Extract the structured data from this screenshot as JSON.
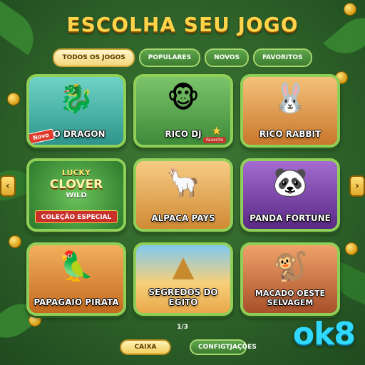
{
  "header": {
    "title": "ESCOLHA SEU JOGO"
  },
  "tabs": [
    {
      "label": "TODOS OS JOGOS",
      "active": true
    },
    {
      "label": "POPULARES",
      "active": false
    },
    {
      "label": "NOVOS",
      "active": false
    },
    {
      "label": "FAVORITOS",
      "active": false
    }
  ],
  "games": [
    {
      "name": "YO DRAGON",
      "badge": "Novo",
      "icon": "dragon-icon",
      "glyph": "🐉",
      "bg": "#3fb3a8"
    },
    {
      "name": "RICO DJ",
      "badge": "Favorito",
      "icon": "monkey-dj-icon",
      "glyph": "🐵",
      "bg": "#4aa05a"
    },
    {
      "name": "RICO RABBIT",
      "icon": "rabbit-icon",
      "glyph": "🐰",
      "bg": "#d98b3a"
    },
    {
      "name": "LUCKY CLOVER WILD",
      "logo_lines": [
        "LUCKY",
        "CLOVER",
        "WILD"
      ],
      "banner": "COLEÇÃO ESPECIAL",
      "icon": "clover-icon",
      "bg": "#3f9a3a"
    },
    {
      "name": "ALPACA PAYS",
      "icon": "alpaca-icon",
      "glyph": "🦙",
      "bg": "#e0a24a"
    },
    {
      "name": "PANDA FORTUNE",
      "icon": "panda-icon",
      "glyph": "🐼",
      "bg": "#7a3ea8"
    },
    {
      "name": "PAPAGAIO PIRATA",
      "icon": "parrot-icon",
      "glyph": "🦜",
      "bg": "#e08a2a"
    },
    {
      "name": "SEGREDOS DO EGITO",
      "icon": "pyramid-icon",
      "glyph": "🔺",
      "bg": "#f2b24a"
    },
    {
      "name": "MACADO OESTE SELVAGEM",
      "icon": "cowboy-monkey-icon",
      "glyph": "🐒",
      "bg": "#c86a3a"
    }
  ],
  "pagination": {
    "text": "1/3"
  },
  "buttons": {
    "caixa": "CAIXA",
    "config": "CONFIGTJAÇÕES"
  },
  "nav": {
    "prev": "‹",
    "next": "›"
  },
  "brand": {
    "logo": "ok8"
  }
}
